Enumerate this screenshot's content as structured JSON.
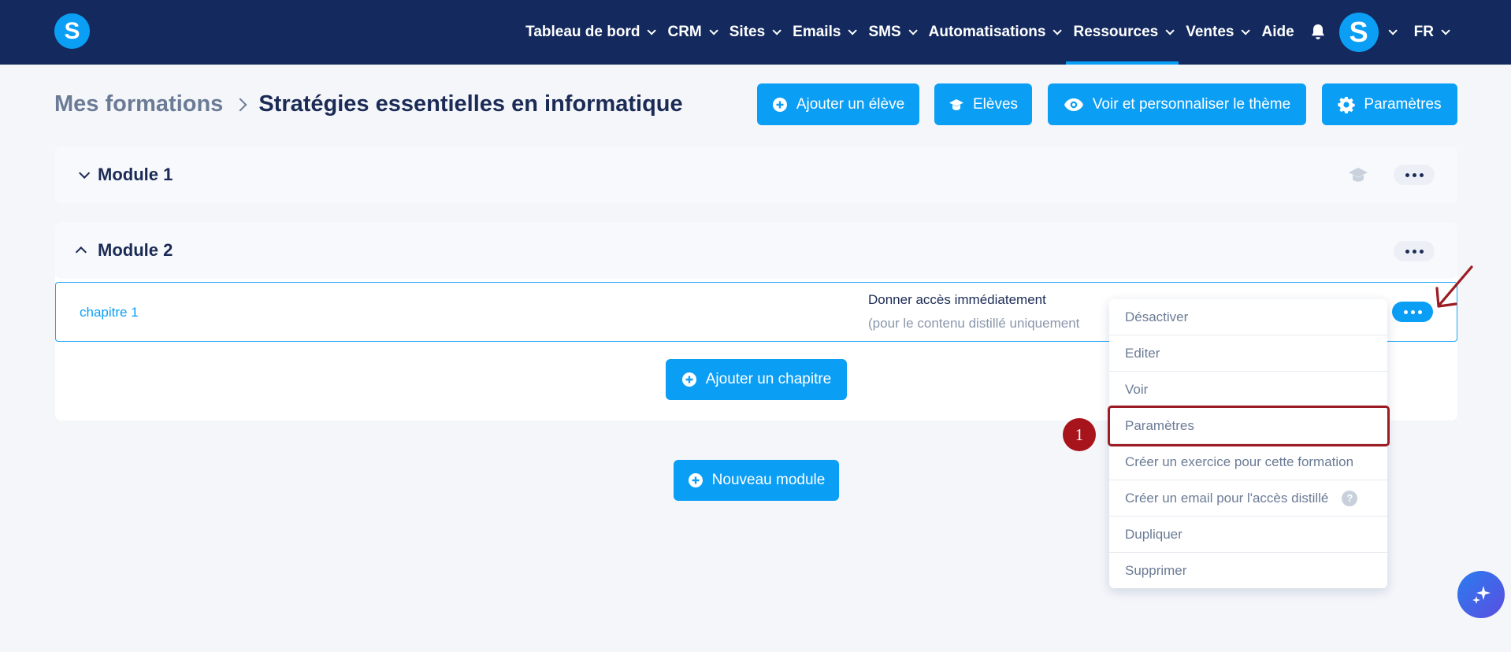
{
  "nav": {
    "logo_letter": "S",
    "items": [
      {
        "label": "Tableau de bord",
        "has_menu": true
      },
      {
        "label": "CRM",
        "has_menu": true
      },
      {
        "label": "Sites",
        "has_menu": true
      },
      {
        "label": "Emails",
        "has_menu": true
      },
      {
        "label": "SMS",
        "has_menu": true
      },
      {
        "label": "Automatisations",
        "has_menu": true
      },
      {
        "label": "Ressources",
        "has_menu": true,
        "active": true
      },
      {
        "label": "Ventes",
        "has_menu": true
      },
      {
        "label": "Aide",
        "has_menu": false
      }
    ],
    "avatar_letter": "S",
    "language": "FR"
  },
  "header": {
    "breadcrumb_root": "Mes formations",
    "breadcrumb_current": "Stratégies essentielles en informatique",
    "buttons": {
      "add_student": "Ajouter un élève",
      "students": "Elèves",
      "theme": "Voir et personnaliser le thème",
      "settings": "Paramètres"
    }
  },
  "modules": [
    {
      "title": "Module 1",
      "expanded": false
    },
    {
      "title": "Module 2",
      "expanded": true,
      "chapters": [
        {
          "name": "chapitre 1",
          "access_title": "Donner accès immédiatement",
          "access_note": "(pour le contenu distillé uniquement"
        }
      ],
      "add_chapter_label": "Ajouter un chapitre"
    }
  ],
  "new_module_label": "Nouveau module",
  "chapter_menu": {
    "items": [
      "Désactiver",
      "Editer",
      "Voir",
      "Paramètres",
      "Créer un exercice pour cette formation",
      "Créer un email pour l'accès distillé",
      "Dupliquer",
      "Supprimer"
    ],
    "help_glyph": "?"
  },
  "annotation": {
    "step_number": "1",
    "color": "#9b1c23"
  },
  "colors": {
    "nav_bg": "#142a5e",
    "accent": "#0b9ef5",
    "page_bg": "#f4f6fa"
  }
}
